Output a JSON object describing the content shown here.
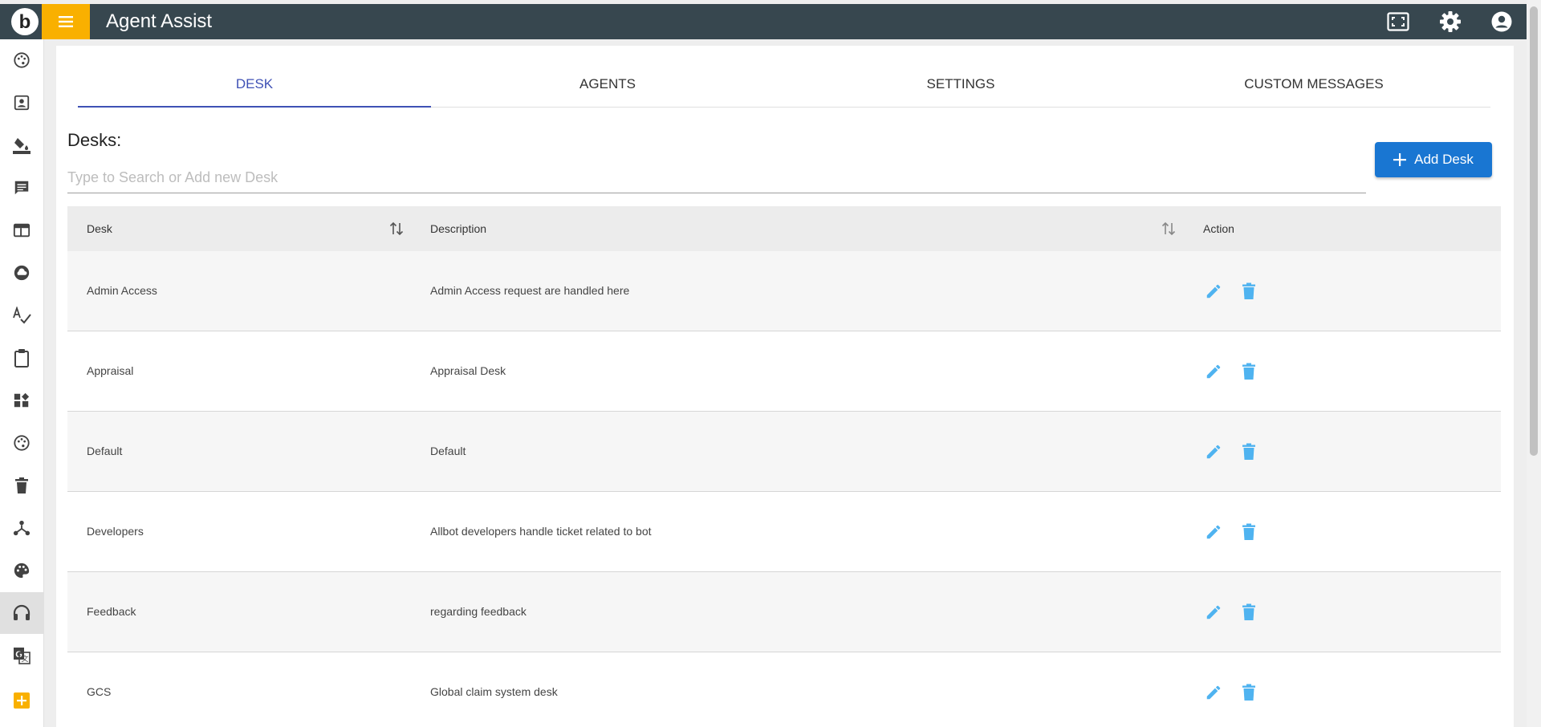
{
  "header": {
    "title": "Agent Assist",
    "logo_letter": "b",
    "accent_color": "#f9b000",
    "bar_color": "#37474f"
  },
  "sidebar": {
    "items": [
      {
        "name": "palette-icon-1"
      },
      {
        "name": "contact-icon"
      },
      {
        "name": "paint-bucket-icon"
      },
      {
        "name": "chat-icon"
      },
      {
        "name": "web-icon"
      },
      {
        "name": "cloud-icon"
      },
      {
        "name": "spellcheck-icon"
      },
      {
        "name": "clipboard-icon"
      },
      {
        "name": "widgets-icon"
      },
      {
        "name": "palette-icon-2"
      },
      {
        "name": "trash-icon"
      },
      {
        "name": "hierarchy-icon"
      },
      {
        "name": "palette-icon-3"
      },
      {
        "name": "headset-icon",
        "active": true
      },
      {
        "name": "translate-icon"
      },
      {
        "name": "add-box-icon"
      }
    ]
  },
  "tabs": [
    "DESK",
    "AGENTS",
    "SETTINGS",
    "CUSTOM MESSAGES"
  ],
  "active_tab": "DESK",
  "desks": {
    "label": "Desks:",
    "search_placeholder": "Type to Search or Add new Desk",
    "add_button": "Add Desk"
  },
  "table": {
    "columns": [
      "Desk",
      "Description",
      "Action"
    ],
    "rows": [
      {
        "desk": "Admin Access",
        "description": "Admin Access request are handled here"
      },
      {
        "desk": "Appraisal",
        "description": "Appraisal Desk"
      },
      {
        "desk": "Default",
        "description": "Default"
      },
      {
        "desk": "Developers",
        "description": "Allbot developers handle ticket related to bot"
      },
      {
        "desk": "Feedback",
        "description": "regarding feedback"
      },
      {
        "desk": "GCS",
        "description": "Global claim system desk"
      }
    ],
    "action_color": "#4fb3f0"
  }
}
